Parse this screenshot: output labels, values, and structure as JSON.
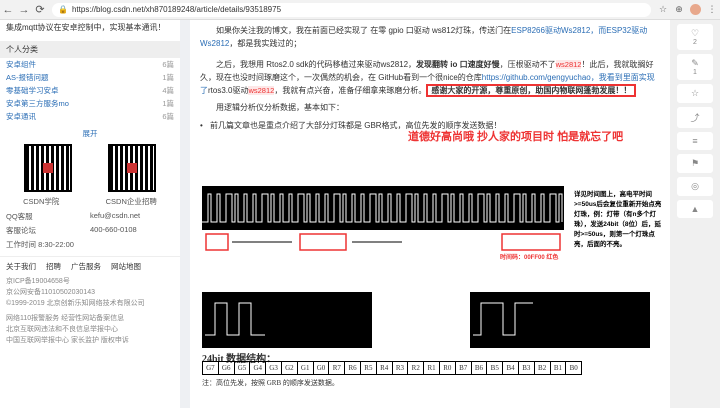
{
  "browser": {
    "url_prefix": "https://blog.csdn.net/",
    "url_path": "xh870189248/article/details/93518975"
  },
  "left": {
    "head_text": "集成mqtt协议在安卓控制中，实现基本通讯！",
    "categories_title": "个人分类",
    "categories": [
      {
        "name": "安卓组件",
        "count": "6篇"
      },
      {
        "name": "AS-报错问题",
        "count": "1篇"
      },
      {
        "name": "零基础学习安卓",
        "count": "4篇"
      },
      {
        "name": "安卓第三方服务mo",
        "count": "1篇"
      },
      {
        "name": "安卓通讯",
        "count": "6篇"
      }
    ],
    "expand": "展开",
    "qr_labels": [
      "CSDN学院",
      "CSDN企业招聘"
    ],
    "contact": [
      "QQ客服",
      "kefu@csdn.net",
      "客服论坛",
      "400-660-0108",
      "工作时间 8:30-22:00",
      ""
    ],
    "links": [
      "关于我们",
      "招聘",
      "广告服务",
      "网站地图"
    ],
    "footer": [
      "京ICP备19004658号",
      "京公网安备11010502030143",
      "©1999-2019 北京创新乐知网络技术有限公司",
      "网络110报警服务  经营性网站备案信息",
      "北京互联网违法和不良信息举报中心",
      "中国互联网举报中心  家长监护  版权申诉"
    ]
  },
  "main": {
    "p1": "如果你关注我的博文，我在前面已经实现了 在零 gpio 口驱动 ws812灯珠，传送门在",
    "p1_link": "ESP8266驱动Ws2812，而ESP32驱动Ws2812",
    "p1_end": "，都是我实践过的；",
    "p2a": "之后，我想用 Rtos2.0 sdk的代码移植过来驱动ws2812，",
    "p2b": "发现翻转 io 口速度好慢",
    "p2c": "，压根驱动不了",
    "p2_tag": "ws2812",
    "p2d": "！此后，我就耽搁好久，现在也没时间琢磨这个，一次偶然的机会，在 GitHub看到一个很nice的仓库",
    "p2_link": "https://github.com/gengyuchao，我看到里面实现了",
    "p2e": "rtos3.0驱动",
    "p2_tag2": "ws2812",
    "p2f": "，我就有点兴奋，准备仔细拿来琢磨分析。",
    "p2_boxed": "感谢大家的开源，尊重原创，助国内物联网蓬勃发展！！",
    "p3": "用逻辑分析仪分析数据，基本如下：",
    "red_comment": "道德好高尚哦  抄人家的项目时  怕是就忘了吧",
    "bullet": "前几篇文章也是重点介绍了大部分灯珠都是 GBR格式，高位先发的顺序发送数据！",
    "notes": "详见时间图上，高电平时间>=50us后会复位重新开始点亮灯珠，例：灯带（有n多个灯珠），发送24bit（8位）后，延时>=50us，则第一个灯珠点亮，后面的不亮。",
    "reset_label": "时间码：00FF00 红色",
    "bit_title": "24bit 数据结构：",
    "bits": [
      "G7",
      "G6",
      "G5",
      "G4",
      "G3",
      "G2",
      "G1",
      "G0",
      "R7",
      "R6",
      "R5",
      "R4",
      "R3",
      "R2",
      "R1",
      "R0",
      "B7",
      "B6",
      "B5",
      "B4",
      "B3",
      "B2",
      "B1",
      "B0"
    ],
    "table_note": "注：高位先发，按照 GRB 的顺序发送数据。"
  },
  "rightbar": {
    "likes": "2",
    "comments": "1",
    "items": [
      "2",
      "1",
      "",
      "",
      "",
      "",
      "",
      ""
    ]
  }
}
